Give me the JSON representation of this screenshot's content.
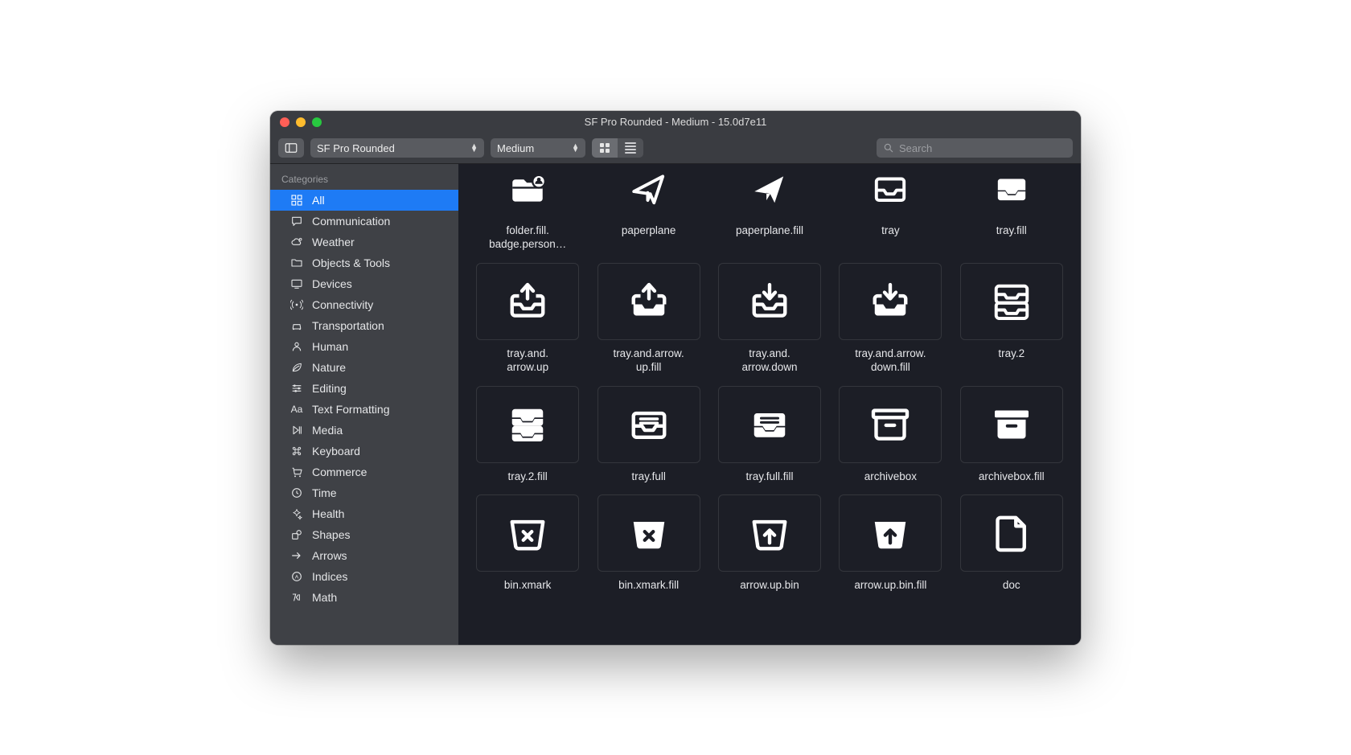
{
  "window": {
    "title": "SF Pro Rounded - Medium - 15.0d7e11"
  },
  "toolbar": {
    "font": "SF Pro Rounded",
    "weight": "Medium",
    "search_placeholder": "Search"
  },
  "sidebar": {
    "header": "Categories",
    "items": [
      {
        "label": "All",
        "iconKey": "grid"
      },
      {
        "label": "Communication",
        "iconKey": "bubble"
      },
      {
        "label": "Weather",
        "iconKey": "cloud"
      },
      {
        "label": "Objects & Tools",
        "iconKey": "folder"
      },
      {
        "label": "Devices",
        "iconKey": "display"
      },
      {
        "label": "Connectivity",
        "iconKey": "antenna"
      },
      {
        "label": "Transportation",
        "iconKey": "car"
      },
      {
        "label": "Human",
        "iconKey": "person"
      },
      {
        "label": "Nature",
        "iconKey": "leaf"
      },
      {
        "label": "Editing",
        "iconKey": "slider"
      },
      {
        "label": "Text Formatting",
        "iconKey": "aa"
      },
      {
        "label": "Media",
        "iconKey": "play"
      },
      {
        "label": "Keyboard",
        "iconKey": "cmd"
      },
      {
        "label": "Commerce",
        "iconKey": "cart"
      },
      {
        "label": "Time",
        "iconKey": "clock"
      },
      {
        "label": "Health",
        "iconKey": "health"
      },
      {
        "label": "Shapes",
        "iconKey": "shapes"
      },
      {
        "label": "Arrows",
        "iconKey": "arrow"
      },
      {
        "label": "Indices",
        "iconKey": "acircle"
      },
      {
        "label": "Math",
        "iconKey": "math"
      }
    ]
  },
  "symbols": [
    {
      "name": "folder.fill.\nbadge.person…",
      "iconKey": "folder_fill_badge"
    },
    {
      "name": "paperplane",
      "iconKey": "paperplane"
    },
    {
      "name": "paperplane.fill",
      "iconKey": "paperplane_fill"
    },
    {
      "name": "tray",
      "iconKey": "tray"
    },
    {
      "name": "tray.fill",
      "iconKey": "tray_fill"
    },
    {
      "name": "tray.and.\narrow.up",
      "iconKey": "tray_arrow_up"
    },
    {
      "name": "tray.and.arrow.\nup.fill",
      "iconKey": "tray_arrow_up_fill"
    },
    {
      "name": "tray.and.\narrow.down",
      "iconKey": "tray_arrow_down"
    },
    {
      "name": "tray.and.arrow.\ndown.fill",
      "iconKey": "tray_arrow_down_fill"
    },
    {
      "name": "tray.2",
      "iconKey": "tray_2"
    },
    {
      "name": "tray.2.fill",
      "iconKey": "tray_2_fill"
    },
    {
      "name": "tray.full",
      "iconKey": "tray_full"
    },
    {
      "name": "tray.full.fill",
      "iconKey": "tray_full_fill"
    },
    {
      "name": "archivebox",
      "iconKey": "archivebox"
    },
    {
      "name": "archivebox.fill",
      "iconKey": "archivebox_fill"
    },
    {
      "name": "bin.xmark",
      "iconKey": "bin_xmark"
    },
    {
      "name": "bin.xmark.fill",
      "iconKey": "bin_xmark_fill"
    },
    {
      "name": "arrow.up.bin",
      "iconKey": "arrow_up_bin"
    },
    {
      "name": "arrow.up.bin.fill",
      "iconKey": "arrow_up_bin_fill"
    },
    {
      "name": "doc",
      "iconKey": "doc"
    }
  ]
}
